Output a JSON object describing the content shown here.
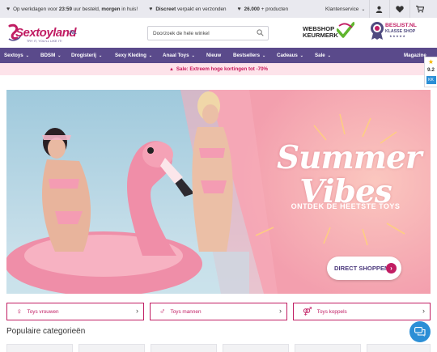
{
  "topbar": {
    "usp1_prefix": "Op werkdagen voor",
    "usp1_time": "23:59",
    "usp1_middle": "uur besteld,",
    "usp1_bold": "morgen",
    "usp1_suffix": "in huis!",
    "usp2_bold": "Discreet",
    "usp2_suffix": "verpakt en verzonden",
    "usp3_bold": "26.000",
    "usp3_suffix": "+ producten",
    "klantenservice": "Klantenservice"
  },
  "header": {
    "logo_text": "Sextoyland",
    "logo_tld": ".NL",
    "logo_tagline": "TRY IT, YOU'LL LIKE IT!",
    "search_placeholder": "Doorzoek de hele winkel",
    "keurmerk_line1": "WEBSHOP",
    "keurmerk_line2": "KEURMERK",
    "beslist_line1": "BESLIST.NL",
    "beslist_line2": "KLASSE SHOP",
    "beslist_stars": "★★★★★"
  },
  "nav": {
    "items": [
      {
        "label": "Sextoys",
        "dropdown": true
      },
      {
        "label": "BDSM",
        "dropdown": true
      },
      {
        "label": "Drogisterij",
        "dropdown": true
      },
      {
        "label": "Sexy Kleding",
        "dropdown": true
      },
      {
        "label": "Anaal Toys",
        "dropdown": true
      },
      {
        "label": "Nieuw",
        "dropdown": false
      },
      {
        "label": "Bestsellers",
        "dropdown": true
      },
      {
        "label": "Cadeaus",
        "dropdown": true
      },
      {
        "label": "Sale",
        "dropdown": true
      }
    ],
    "magazine": "Magazine"
  },
  "sale_banner": "Sale: Extreem hoge kortingen tot -70%",
  "rating": {
    "star": "★",
    "score": "9.2",
    "badge": "KK"
  },
  "hero": {
    "title_line1": "Summer",
    "title_line2": "Vibes",
    "subtitle": "ONTDEK DE HEETSTE TOYS",
    "cta": "DIRECT SHOPPEN",
    "cta_arrow": "›"
  },
  "categories": [
    {
      "symbol": "♀",
      "label": "Toys vrouwen",
      "arrow": "›"
    },
    {
      "symbol": "♂",
      "label": "Toys mannen",
      "arrow": "›"
    },
    {
      "symbol": "⚤",
      "label": "Toys koppels",
      "arrow": "›"
    }
  ],
  "populaire_title": "Populaire categorieën",
  "colors": {
    "nav_bg": "#5a4a8b",
    "accent": "#c11d63",
    "sale_bg": "#fde3ea",
    "topbar_bg": "#e9e9ef",
    "chat": "#2c8fd6"
  }
}
